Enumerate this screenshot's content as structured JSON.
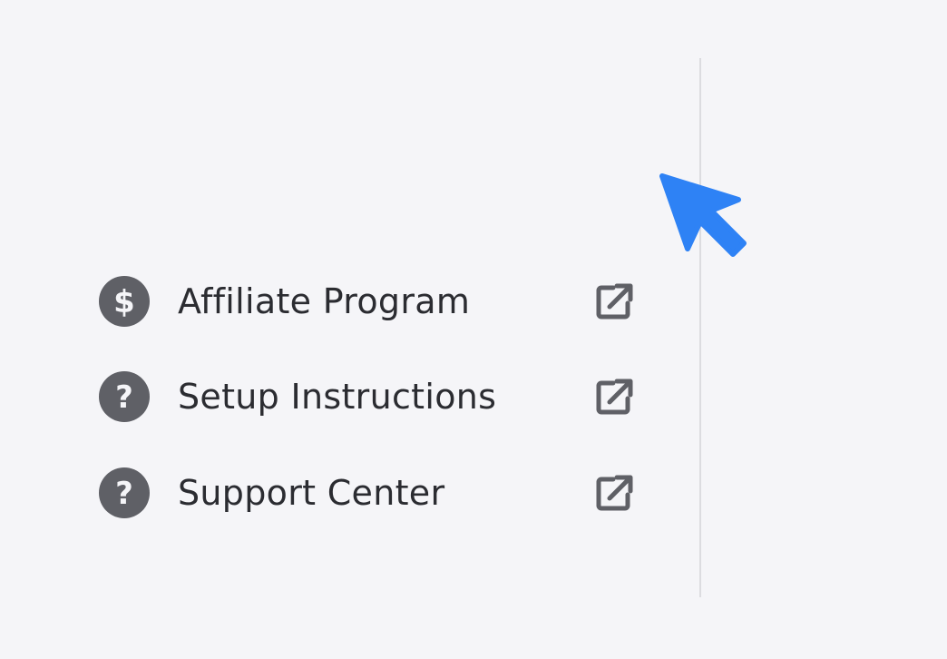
{
  "menu": {
    "items": [
      {
        "label": "Affiliate Program",
        "icon": "dollar-circle-icon",
        "trailing_icon": "external-link-icon"
      },
      {
        "label": "Setup Instructions",
        "icon": "question-circle-icon",
        "trailing_icon": "external-link-icon"
      },
      {
        "label": "Support Center",
        "icon": "question-circle-icon",
        "trailing_icon": "external-link-icon"
      }
    ]
  },
  "colors": {
    "background": "#f5f5f8",
    "icon": "#5f6066",
    "text": "#2b2c31",
    "divider": "#dcdce0",
    "cursor": "#2e82f5"
  }
}
